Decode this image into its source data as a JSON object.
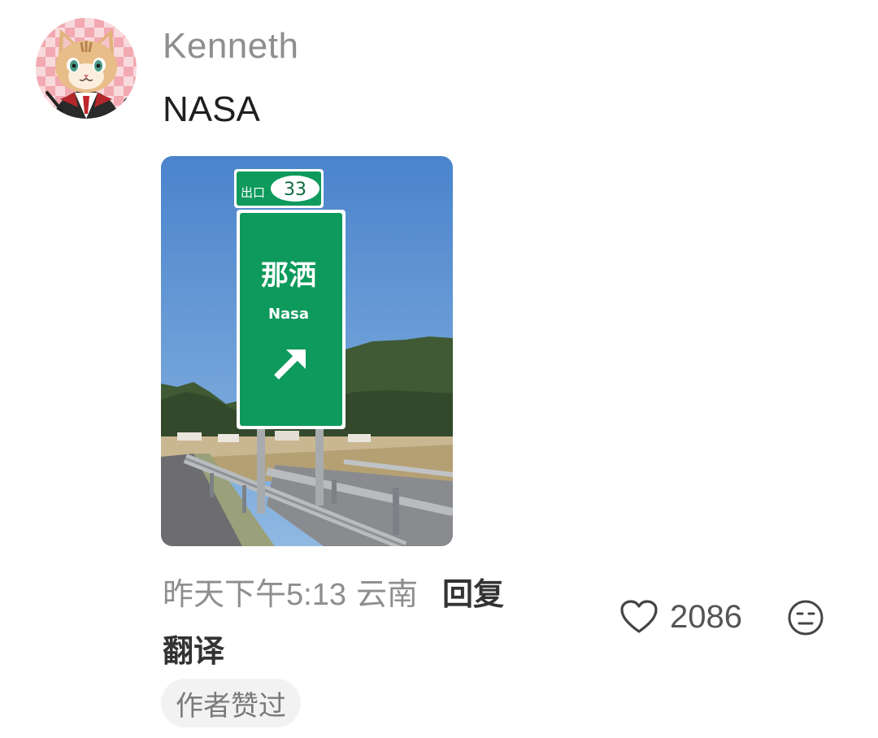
{
  "comment": {
    "author": "Kenneth",
    "text": "NASA",
    "timestamp": "昨天下午5:13",
    "location": "云南",
    "reply_label": "回复",
    "translate_label": "翻译",
    "author_liked_badge": "作者赞过",
    "like_count": "2086",
    "like_icon": "heart-outline-icon",
    "dislike_icon": "meh-face-icon"
  },
  "photo": {
    "exit_label": "出口",
    "exit_number": "33",
    "sign_chinese": "那洒",
    "sign_pinyin": "Nasa",
    "sign_color": "#0e9a5c",
    "sky_color": "#4f88cf"
  }
}
